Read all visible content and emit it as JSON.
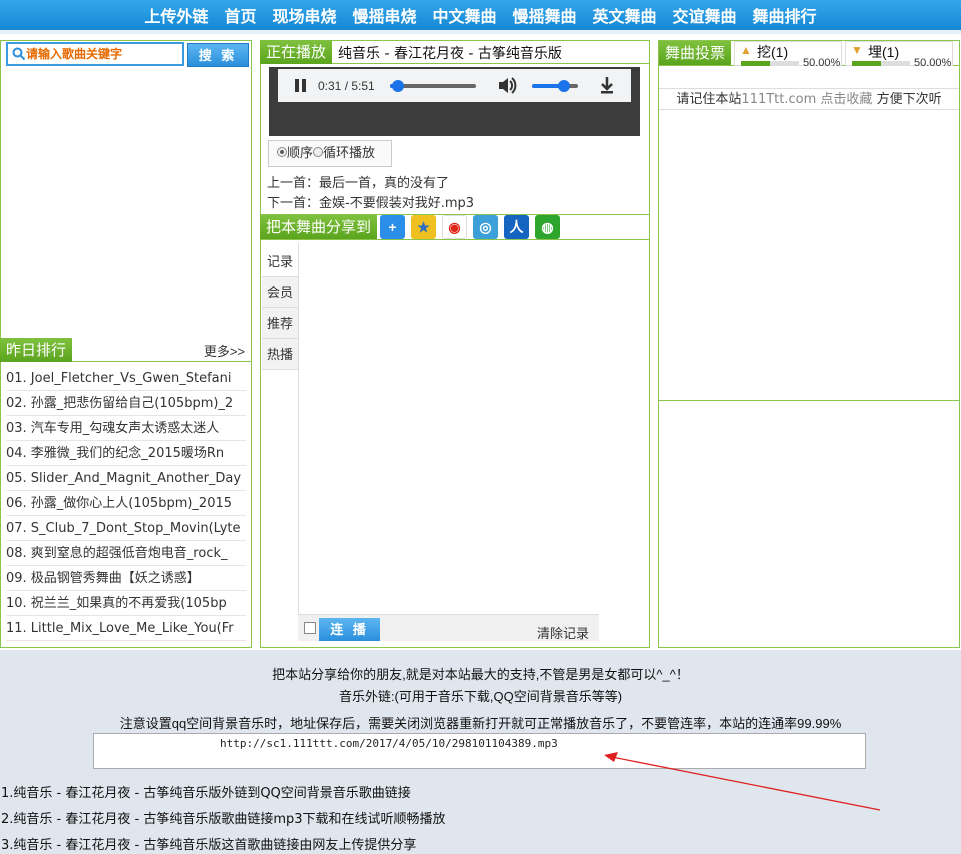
{
  "nav": [
    "上传外链",
    "首页",
    "现场串烧",
    "慢摇串烧",
    "中文舞曲",
    "慢摇舞曲",
    "英文舞曲",
    "交谊舞曲",
    "舞曲排行"
  ],
  "search": {
    "placeholder": "请输入歌曲关键字",
    "button": "搜 索"
  },
  "rank": {
    "title": "昨日排行",
    "more": "更多>>",
    "items": [
      "01. Joel_Fletcher_Vs_Gwen_Stefani",
      "02. 孙露_把悲伤留给自己(105bpm)_2",
      "03. 汽车专用_勾魂女声太诱惑太迷人",
      "04. 李雅微_我们的纪念_2015暖场Rn",
      "05. Slider_And_Magnit_Another_Day",
      "06. 孙露_做你心上人(105bpm)_2015",
      "07. S_Club_7_Dont_Stop_Movin(Lyte",
      "08. 爽到窒息的超强低音炮电音_rock_",
      "09. 极品钢管秀舞曲【妖之诱惑】",
      "10. 祝兰兰_如果真的不再爱我(105bp",
      "11. Little_Mix_Love_Me_Like_You(Fr"
    ]
  },
  "player": {
    "heading": "正在播放",
    "song": "纯音乐 - 春江花月夜 - 古筝纯音乐版",
    "time": "0:31 / 5:51",
    "progress": 0.09,
    "volume": 0.7,
    "mode_order": "顺序",
    "mode_loop": "循环播放",
    "prev": "上一首：最后一首，真的没有了",
    "next": "下一首：金娱-不要假装对我好.mp3"
  },
  "share": {
    "heading": "把本舞曲分享到"
  },
  "tabs": [
    "记录",
    "会员",
    "推荐",
    "热播"
  ],
  "history": {
    "connect": "连 播",
    "clear": "清除记录"
  },
  "vote": {
    "heading": "舞曲投票",
    "dig": "挖(1)",
    "dig_pct": "50.00%",
    "dig_value": 0.5,
    "bury": "埋(1)",
    "bury_pct": "50.00%",
    "bury_value": 0.5,
    "note_a": "请记住本站",
    "note_site": "111Ttt.com",
    "note_b": "点击收藏",
    "note_c": "方便下次听"
  },
  "bottom": {
    "line1": "把本站分享给你的朋友,就是对本站最大的支持,不管是男是女都可以^_^！",
    "line2": "音乐外链:(可用于音乐下载,QQ空间背景音乐等等)",
    "line3": "注意设置qq空间背景音乐时，地址保存后，需要关闭浏览器重新打开就可正常播放音乐了，不要管连率，本站的连通率99.99%",
    "url": "http://sc1.111ttt.com/2017/4/05/10/298101104389.mp3",
    "link1": "1.纯音乐 - 春江花月夜 - 古筝纯音乐版外链到QQ空间背景音乐歌曲链接",
    "link2": "2.纯音乐 - 春江花月夜 - 古筝纯音乐版歌曲链接mp3下载和在线试听顺畅播放",
    "link3": "3.纯音乐 - 春江花月夜 - 古筝纯音乐版这首歌曲链接由网友上传提供分享"
  },
  "colors": {
    "nav": "#1f8fde",
    "green": "#6cb32e",
    "orange": "#e66a00",
    "bottom_bg": "#dfe6ee"
  }
}
